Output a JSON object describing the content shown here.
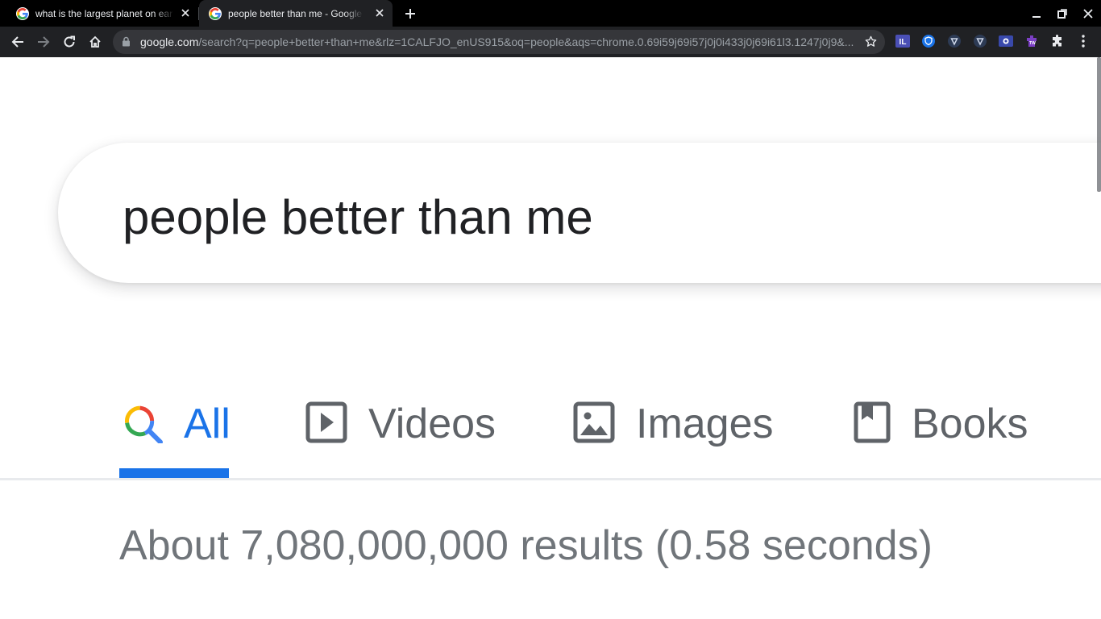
{
  "browser": {
    "tabs": [
      {
        "title": "what is the largest planet on ear",
        "active": false
      },
      {
        "title": "people better than me - Google S",
        "active": true
      }
    ],
    "address_bar": {
      "host": "google.com",
      "path": "/search?q=people+better+than+me&rlz=1CALFJO_enUS915&oq=people&aqs=chrome.0.69i59j69i57j0j0i433j0j69i61l3.1247j0j9&..."
    },
    "extensions": [
      "il-extension-icon",
      "shield-extension-icon",
      "vpn-extension-icon",
      "vpn-extension-icon-2",
      "screen-extension-icon",
      "tw-extension-icon",
      "puzzle-icon"
    ]
  },
  "search": {
    "query": "people better than me"
  },
  "search_tabs": [
    {
      "label": "All",
      "icon": "search-color-icon",
      "active": true
    },
    {
      "label": "Videos",
      "icon": "play-box-icon",
      "active": false
    },
    {
      "label": "Images",
      "icon": "image-icon",
      "active": false
    },
    {
      "label": "Books",
      "icon": "book-icon",
      "active": false
    }
  ],
  "result_stats": "About 7,080,000,000 results (0.58 seconds)",
  "colors": {
    "accent": "#1a73e8",
    "tab_text": "#5f6368",
    "chrome_dark": "#202124"
  }
}
